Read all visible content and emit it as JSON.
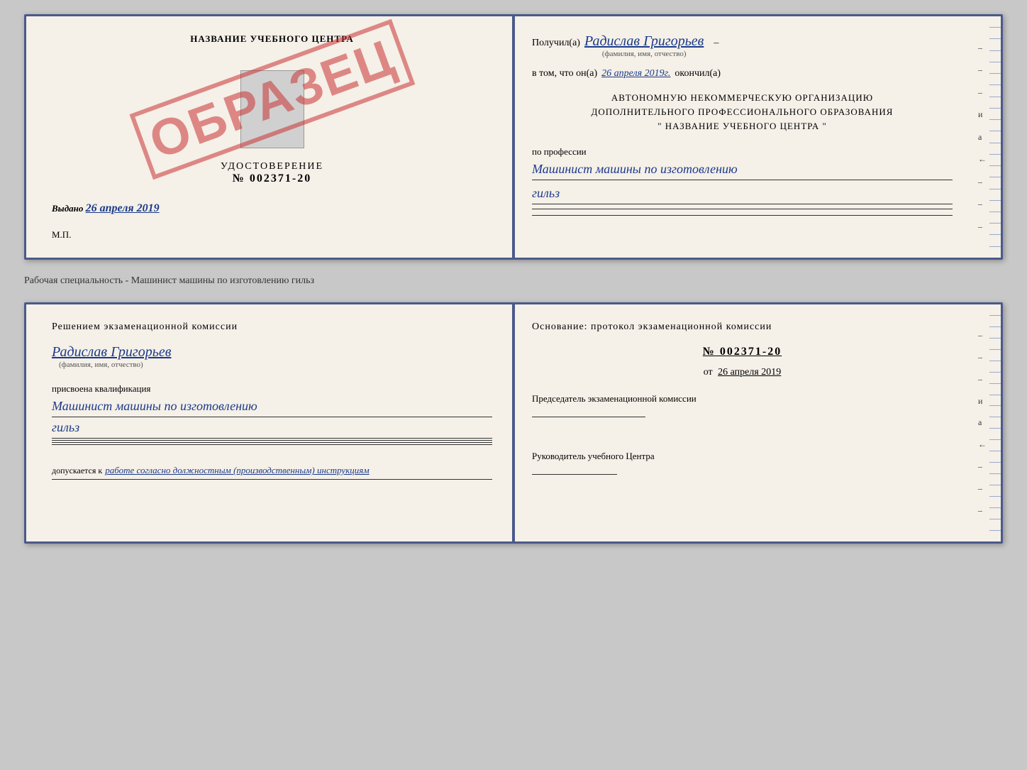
{
  "page": {
    "background": "#c8c8c8"
  },
  "top_doc": {
    "left": {
      "school_name": "НАЗВАНИЕ УЧЕБНОГО ЦЕНТРА",
      "cert_title": "УДОСТОВЕРЕНИЕ",
      "cert_number": "№ 002371-20",
      "stamp_text": "ОБРАЗЕЦ",
      "issued_label": "Выдано",
      "issued_date": "26 апреля 2019",
      "mp_label": "М.П."
    },
    "right": {
      "received_label": "Получил(а)",
      "recipient_name": "Радислав Григорьев",
      "name_hint": "(фамилия, имя, отчество)",
      "date_prefix": "в том, что он(а)",
      "date_value": "26 апреля 2019г.",
      "date_suffix": "окончил(а)",
      "org_line1": "АВТОНОМНУЮ НЕКОММЕРЧЕСКУЮ ОРГАНИЗАЦИЮ",
      "org_line2": "ДОПОЛНИТЕЛЬНОГО ПРОФЕССИОНАЛЬНОГО ОБРАЗОВАНИЯ",
      "org_line3": "\"   НАЗВАНИЕ УЧЕБНОГО ЦЕНТРА   \"",
      "profession_label": "по профессии",
      "profession_value": "Машинист машины по изготовлению",
      "profession_value2": "гильз"
    }
  },
  "separator": {
    "text": "Рабочая специальность - Машинист машины по изготовлению гильз"
  },
  "bottom_doc": {
    "left": {
      "decision_title": "Решением  экзаменационной  комиссии",
      "person_name": "Радислав Григорьев",
      "name_hint": "(фамилия, имя, отчество)",
      "qualification_label": "присвоена квалификация",
      "qualification_value": "Машинист машины по изготовлению",
      "qualification_value2": "гильз",
      "allowed_label": "допускается к",
      "allowed_value": "работе согласно должностным (производственным) инструкциям"
    },
    "right": {
      "basis_title": "Основание: протокол экзаменационной  комиссии",
      "protocol_number": "№  002371-20",
      "date_prefix": "от",
      "date_value": "26 апреля 2019",
      "chairman_title": "Председатель экзаменационной комиссии",
      "director_title": "Руководитель учебного Центра"
    }
  }
}
